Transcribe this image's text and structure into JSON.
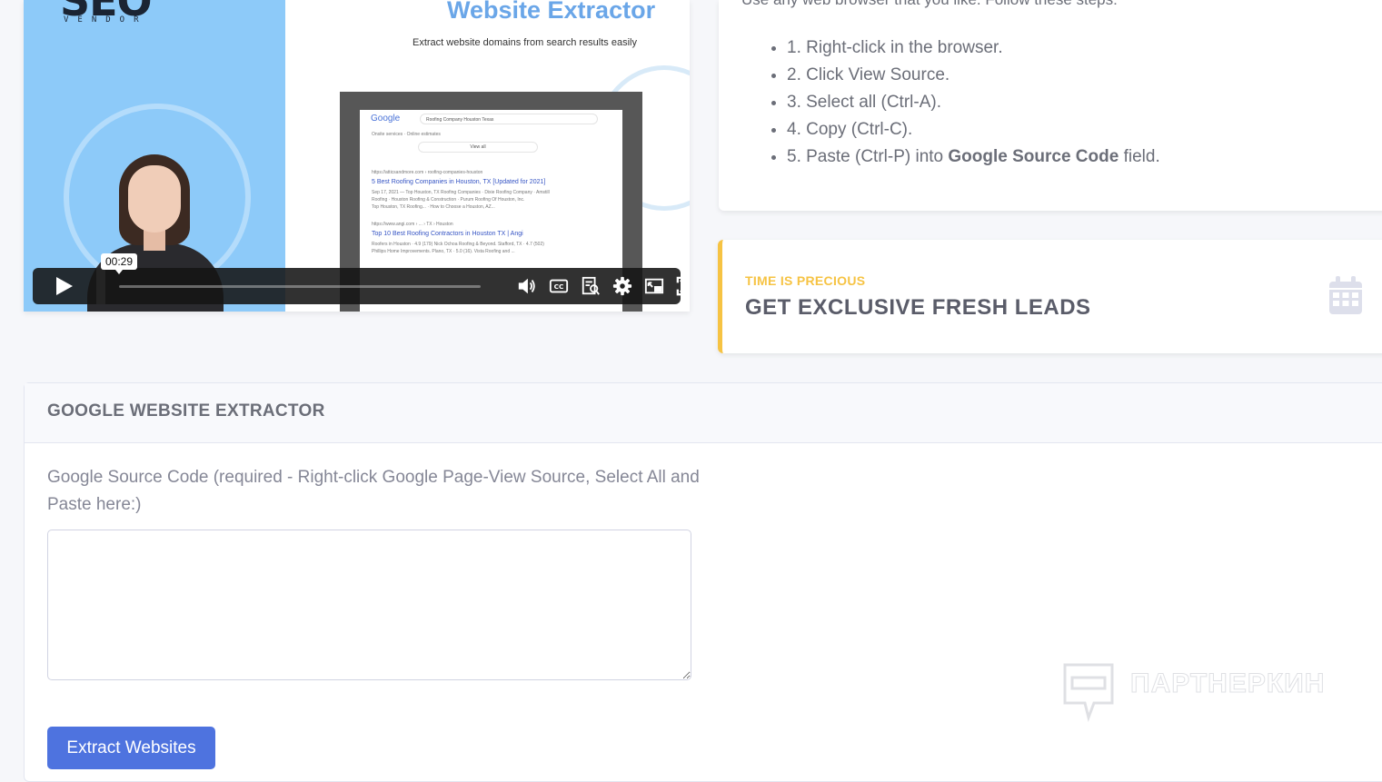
{
  "video": {
    "brand_logo": "SEO",
    "brand_sub": "VENDOR",
    "title": "Website Extractor",
    "subtitle": "Extract website domains from search results easily",
    "time_tooltip": "00:29",
    "mock_search": {
      "logo": "Google",
      "query": "Roofing Company Houston Texas",
      "lines": [
        "Onsite services · Online estimates",
        "View all",
        "https://atticsandmore.com › roofing-companies-houston",
        "5 Best Roofing Companies in Houston, TX [Updated for 2021]",
        "Sep 17, 2021 — Top Houston, TX Roofing Companies · Dixie Roofing Company · Amstill",
        "Roofing · Houston Roofing & Construction · Purum Roofing Of Houston, Inc.",
        "Top Houston, TX Roofing... · How to Choose a Houston, AZ...",
        "https://www.angi.com › ... › TX › Houston",
        "Top 10 Best Roofing Contractors in Houston TX | Angi",
        "Roofers in Houston · 4.9 (179) Nick Ochoa Roofing & Beyond. Stafford, TX · 4.7 (502)",
        "Phillips Home Improvements. Plano, TX · 5.0 (16). Vista Roofing and ..."
      ]
    }
  },
  "steps": {
    "intro": "Use any web browser that you like. Follow these steps:",
    "items": [
      {
        "text": "1. Right-click in the browser."
      },
      {
        "text": "2. Click View Source."
      },
      {
        "text": "3. Select all (Ctrl-A)."
      },
      {
        "text": "4. Copy (Ctrl-C)."
      },
      {
        "text_before": "5. Paste (Ctrl-P) into ",
        "bold": "Google Source Code",
        "text_after": " field."
      }
    ]
  },
  "leads": {
    "kicker": "TIME IS PRECIOUS",
    "heading": "GET EXCLUSIVE FRESH LEADS",
    "icon": "calendar-icon"
  },
  "extractor": {
    "title": "GOOGLE WEBSITE EXTRACTOR",
    "field_label": "Google Source Code (required - Right-click Google Page-View Source, Select All and Paste here:)",
    "field_value": "",
    "button_label": "Extract Websites"
  },
  "watermark": {
    "text": "ПАРТНЕРКИН"
  },
  "colors": {
    "primary": "#4e73df",
    "warning": "#f6c343",
    "video_left_bg": "#8dcaf9",
    "video_title": "#6aa6e8"
  }
}
